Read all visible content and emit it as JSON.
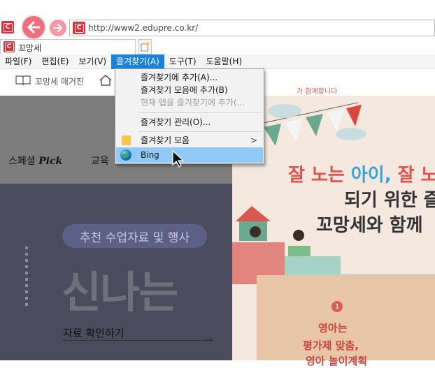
{
  "browser": {
    "url": "http://www2.edupre.co.kr/",
    "tab_title": "꼬망세",
    "logo_letter": "C"
  },
  "menubar": {
    "items": [
      "파일(F)",
      "편집(E)",
      "보기(V)",
      "즐겨찾기(A)",
      "도구(T)",
      "도움말(H)"
    ],
    "open_index": 3
  },
  "dropdown": {
    "items": [
      {
        "label": "즐겨찾기에 추가(A)...",
        "enabled": true
      },
      {
        "label": "즐겨찾기 모음에 추가(B)",
        "enabled": true
      },
      {
        "label": "현재 탭을 즐겨찾기에 추가(...",
        "enabled": false
      },
      {
        "label": "즐겨찾기 관리(O)...",
        "enabled": true
      },
      {
        "label": "즐겨찾기 모음",
        "enabled": true,
        "submenu_arrow": ">"
      },
      {
        "label": "Bing",
        "enabled": true,
        "highlighted": true
      }
    ]
  },
  "page": {
    "site_label": "꼬망세 매거진",
    "nav_special": "스페셜",
    "nav_pick": "Pick",
    "nav_edu": "교육",
    "pill": "추천 수업자료 및 행사",
    "big_text": "신나는",
    "confirm": "자료 확인하기",
    "confirm_arrow": "→",
    "banner_top": "가 함께합니다",
    "headline_a": "잘 노는 ",
    "headline_b": "아이, ",
    "headline_c": "잘 노",
    "headline2": "되기 위한 즐",
    "headline3": "꼬망세와 함께",
    "badge": "1",
    "sub1": "영아는",
    "sub2": "평가제 맞춤,",
    "sub3": "영아 놀이계획"
  },
  "colors": {
    "accent": "#1a83d9",
    "highlight": "#91c9f7",
    "back_button": "#f06e7e"
  }
}
